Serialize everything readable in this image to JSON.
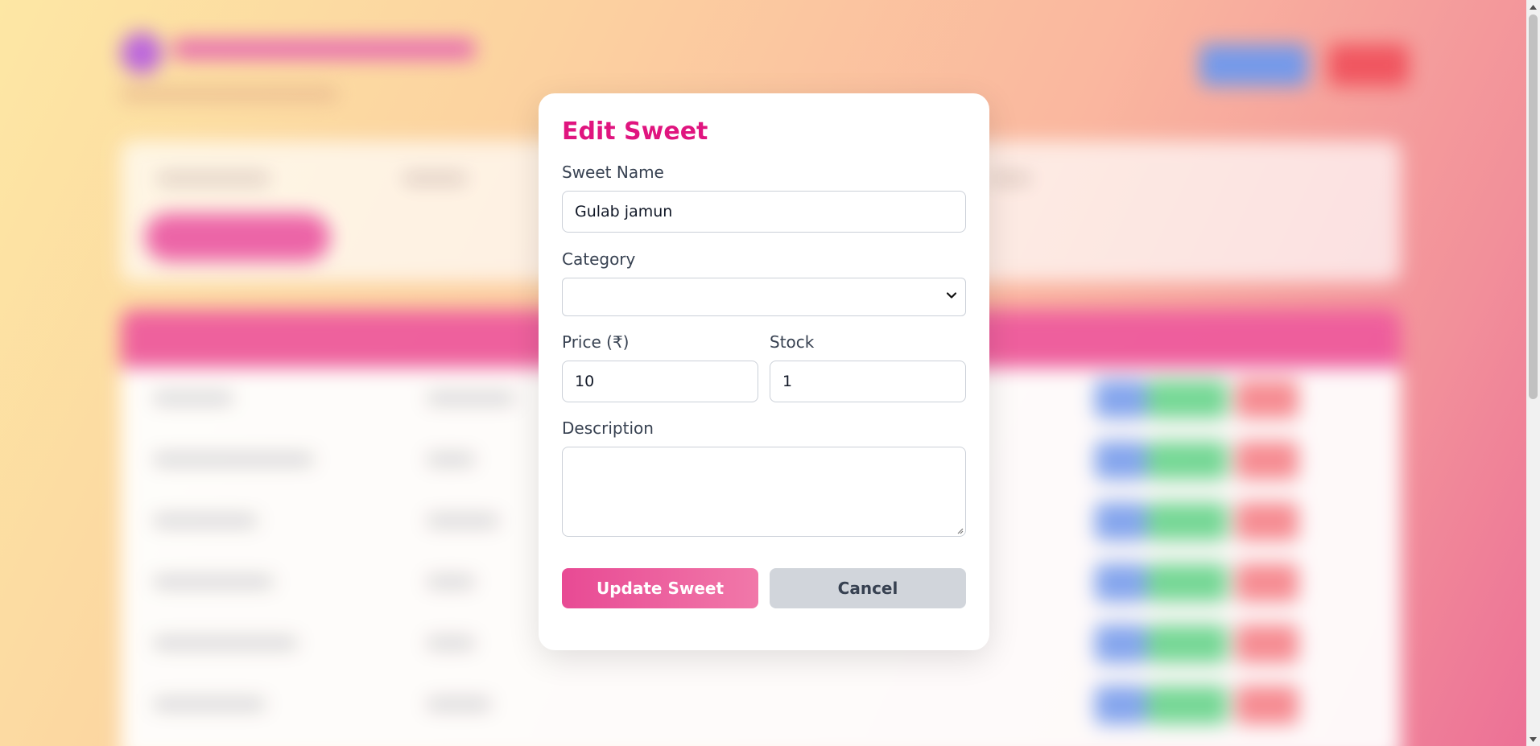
{
  "modal": {
    "title": "Edit Sweet",
    "name_label": "Sweet Name",
    "name_value": "Gulab jamun",
    "category_label": "Category",
    "category_value": "",
    "price_label": "Price (₹)",
    "price_value": "10",
    "stock_label": "Stock",
    "stock_value": "1",
    "description_label": "Description",
    "description_value": "",
    "update_label": "Update Sweet",
    "cancel_label": "Cancel"
  },
  "colors": {
    "title": "#e0157f",
    "primary_button_start": "#e84a94",
    "primary_button_end": "#f178a9",
    "cancel_button": "#d1d5db"
  },
  "icons": {
    "select": "chevron-down-icon",
    "textarea": "resize-grip-icon",
    "scroll_up": "scroll-up-arrow-icon",
    "scroll_down": "scroll-down-arrow-icon"
  }
}
